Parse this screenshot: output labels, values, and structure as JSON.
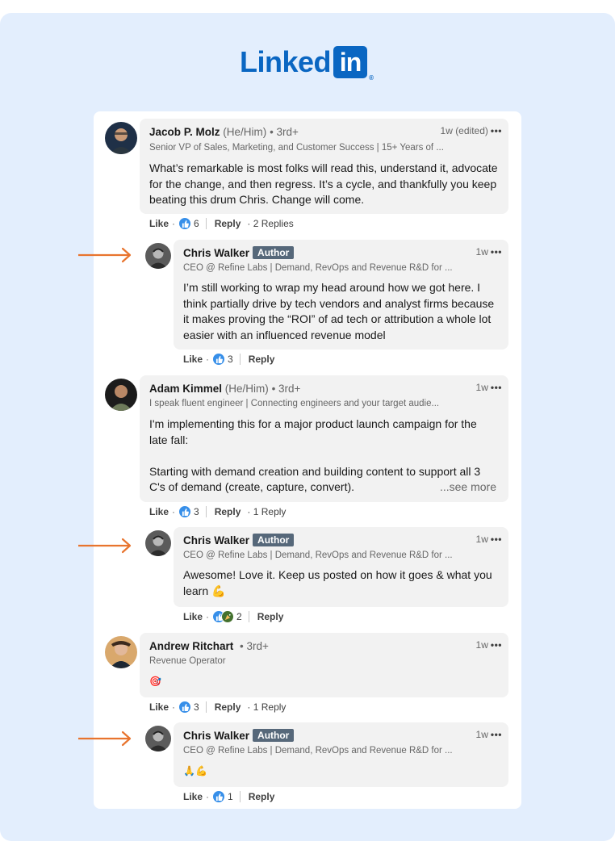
{
  "logo": {
    "text": "Linked",
    "box_text": "in",
    "reg": "®"
  },
  "colors": {
    "brand": "#0a66c2",
    "badge": "#56687a",
    "arrow": "#e8742e",
    "like": "#378fe9"
  },
  "comments": [
    {
      "name": "Jacob P. Molz",
      "pronouns": "(He/Him)",
      "degree": "• 3rd+",
      "headline": "Senior VP of Sales, Marketing, and Customer Success | 15+ Years of ...",
      "time": "1w (edited)",
      "more": "•••",
      "body": [
        "What’s remarkable is most folks will read this, understand it, advocate",
        "for the change, and then regress. It’s a cycle, and thankfully you keep",
        "beating this drum Chris. Change will come."
      ],
      "like": "Like",
      "dot": "·",
      "reactions": "6",
      "reply": "Reply",
      "replies": "· 2 Replies"
    },
    {
      "name": "Chris Walker",
      "badge": "Author",
      "headline": "CEO @ Refine Labs | Demand, RevOps and Revenue R&D for ...",
      "time": "1w",
      "more": "•••",
      "body": [
        "I’m still working to wrap my head around how we got here. I",
        "think partially drive by tech vendors and analyst firms because",
        "it makes proving the “ROI” of ad tech or attribution a whole lot",
        "easier with an influenced revenue model"
      ],
      "like": "Like",
      "dot": "·",
      "reactions": "3",
      "reply": "Reply"
    },
    {
      "name": "Adam Kimmel",
      "pronouns": "(He/Him)",
      "degree": "• 3rd+",
      "headline": "I speak fluent engineer | Connecting engineers and your target audie...",
      "time": "1w",
      "more": "•••",
      "body": [
        "I'm implementing this for a major product launch campaign for the",
        "late fall:",
        "",
        "Starting with demand creation and building content to support all 3",
        "C's of demand (create, capture, convert)."
      ],
      "see_more": "...see more",
      "like": "Like",
      "dot": "·",
      "reactions": "3",
      "reply": "Reply",
      "replies": "· 1 Reply"
    },
    {
      "name": "Chris Walker",
      "badge": "Author",
      "headline": "CEO @ Refine Labs | Demand, RevOps and Revenue R&D for ...",
      "time": "1w",
      "more": "•••",
      "body": [
        "Awesome! Love it. Keep us posted on how it goes & what you",
        "learn 💪"
      ],
      "like": "Like",
      "dot": "·",
      "reactions": "2",
      "reply": "Reply"
    },
    {
      "name": "Andrew Ritchart",
      "degree": "• 3rd+",
      "headline": "Revenue Operator",
      "time": "1w",
      "more": "•••",
      "body": [
        "🎯"
      ],
      "like": "Like",
      "dot": "·",
      "reactions": "3",
      "reply": "Reply",
      "replies": "· 1 Reply"
    },
    {
      "name": "Chris Walker",
      "badge": "Author",
      "headline": "CEO @ Refine Labs | Demand, RevOps and Revenue R&D for ...",
      "time": "1w",
      "more": "•••",
      "body": [
        "🙏💪"
      ],
      "like": "Like",
      "dot": "·",
      "reactions": "1",
      "reply": "Reply"
    }
  ]
}
